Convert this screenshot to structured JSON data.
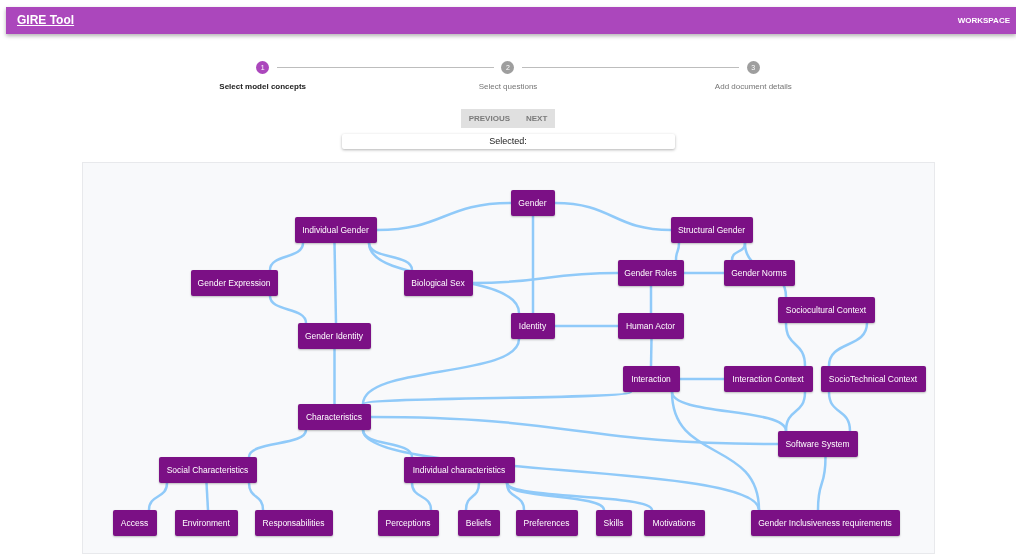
{
  "app_bar": {
    "title": "GIRE Tool",
    "nav_link": "WORKSPACE"
  },
  "steps": [
    {
      "number": "1",
      "label": "Select model concepts",
      "selected": true
    },
    {
      "number": "2",
      "label": "Select questions",
      "selected": false
    },
    {
      "number": "3",
      "label": "Add document details",
      "selected": false
    }
  ],
  "buttons": [
    {
      "label": "PREVIOUS",
      "disabled": true
    },
    {
      "label": "NEXT",
      "disabled": true
    }
  ],
  "selected_panel": {
    "label": "Selected:"
  },
  "diagram": {
    "nodes": [
      {
        "label": "Gender"
      },
      {
        "label": "Individual Gender"
      },
      {
        "label": "Structural Gender"
      },
      {
        "label": "Gender Expression"
      },
      {
        "label": "Biological Sex"
      },
      {
        "label": "Gender Roles"
      },
      {
        "label": "Gender Norms"
      },
      {
        "label": "Sociocultural Context"
      },
      {
        "label": "Identity"
      },
      {
        "label": "Human Actor"
      },
      {
        "label": "Gender Identity"
      },
      {
        "label": "Interaction"
      },
      {
        "label": "Interaction Context"
      },
      {
        "label": "SocioTechnical Context"
      },
      {
        "label": "Characteristics"
      },
      {
        "label": "Software System"
      },
      {
        "label": "Social Characteristics"
      },
      {
        "label": "Individual characteristics"
      },
      {
        "label": "Access"
      },
      {
        "label": "Environment"
      },
      {
        "label": "Responsabilities"
      },
      {
        "label": "Perceptions"
      },
      {
        "label": "Beliefs"
      },
      {
        "label": "Preferences"
      },
      {
        "label": "Skills"
      },
      {
        "label": "Motivations"
      },
      {
        "label": "Gender Inclusiveness requirements"
      }
    ]
  }
}
